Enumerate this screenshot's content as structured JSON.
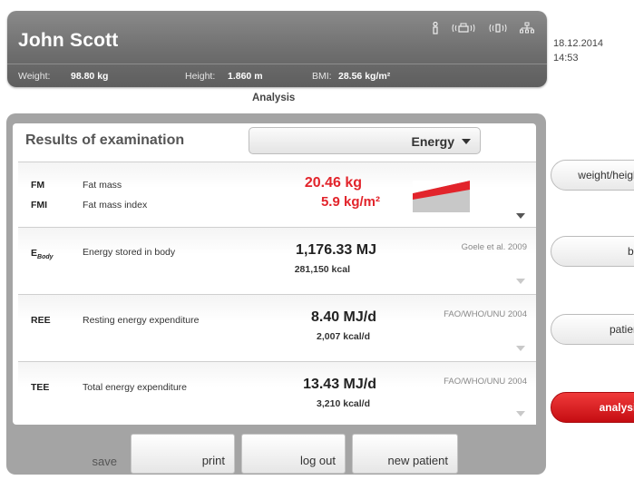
{
  "header": {
    "patient_name": "John Scott",
    "weight_label": "Weight:",
    "weight_value": "98.80 kg",
    "height_label": "Height:",
    "height_value": "1.860 m",
    "bmi_label": "BMI:",
    "bmi_value": "28.56 kg/m²",
    "status_icons": [
      "person-icon",
      "printer-wireless-icon",
      "wireless-info-icon",
      "network-icon"
    ]
  },
  "datetime": {
    "date": "18.12.2014",
    "time": "14:53"
  },
  "page_title": "Analysis",
  "results": {
    "title": "Results of examination",
    "dropdown_value": "Energy"
  },
  "rows": [
    {
      "lines": [
        {
          "abbr": "FM",
          "desc": "Fat mass",
          "value": "20.46 kg"
        },
        {
          "abbr": "FMI",
          "desc": "Fat mass index",
          "value": "5.9 kg/m²"
        }
      ],
      "value_color": "#e2242b",
      "indicator_level": 0.6
    },
    {
      "abbr": "E_Body",
      "abbr_main": "E",
      "abbr_sub": "Body",
      "desc": "Energy stored in body",
      "value": "1,176.33 MJ",
      "sub_value": "281,150 kcal",
      "reference": "Goele et al. 2009"
    },
    {
      "abbr": "REE",
      "desc": "Resting energy expenditure",
      "value": "8.40 MJ/d",
      "sub_value": "2,007 kcal/d",
      "reference": "FAO/WHO/UNU 2004"
    },
    {
      "abbr": "TEE",
      "desc": "Total energy expenditure",
      "value": "13.43 MJ/d",
      "sub_value": "3,210 kcal/d",
      "reference": "FAO/WHO/UNU 2004"
    }
  ],
  "bottom_buttons": {
    "save": "save",
    "print": "print",
    "logout": "log out",
    "new_patient": "new patient"
  },
  "side_nav": {
    "weight_height": "weight/height",
    "bia": "bia",
    "patient": "patient",
    "analysis": "analysis",
    "active": "analysis"
  },
  "colors": {
    "accent_red": "#e2242b",
    "header_gray": "#6e6e6e",
    "panel_gray": "#a4a4a4"
  }
}
